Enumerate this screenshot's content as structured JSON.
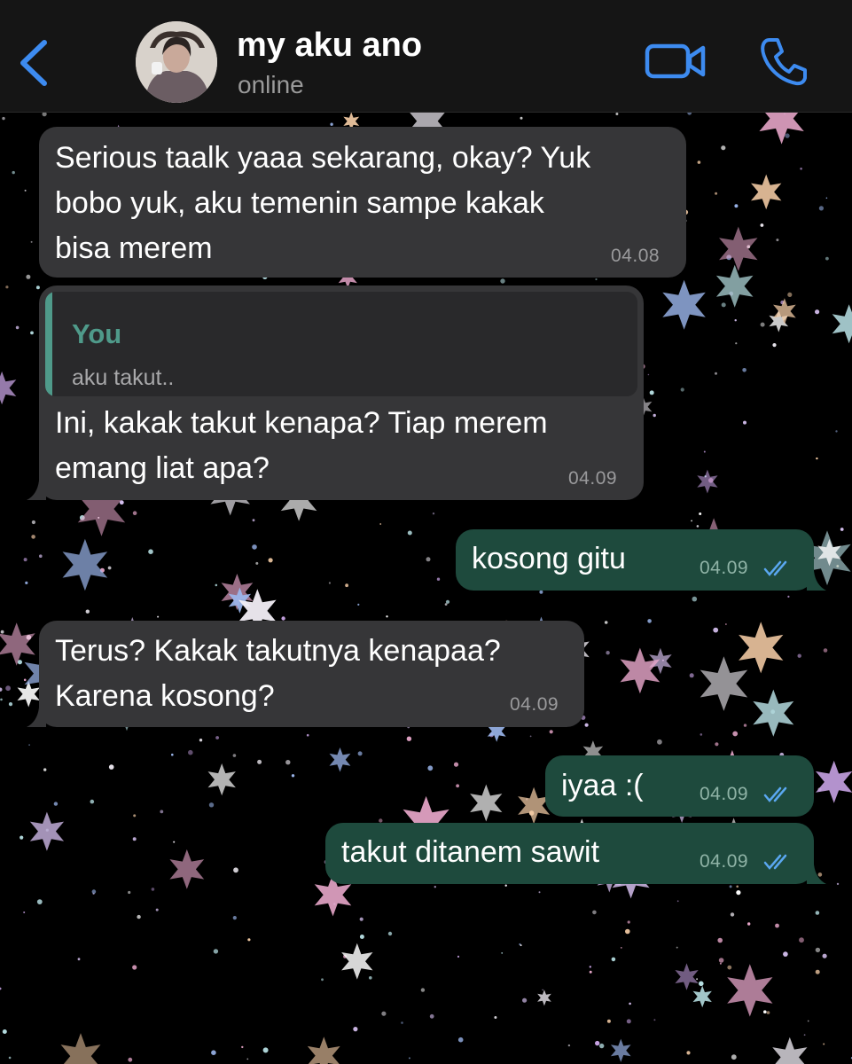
{
  "header": {
    "contact_name": "my aku ano",
    "status": "online",
    "back_icon": "chevron-left-icon",
    "video_icon": "video-camera-icon",
    "call_icon": "phone-icon",
    "accent_color": "#3d8bf0"
  },
  "messages": [
    {
      "direction": "incoming",
      "lines": [
        "Serious taalk yaaa sekarang, okay? Yuk",
        "bobo yuk, aku temenin sampe kakak",
        "bisa merem"
      ],
      "time": "04.08"
    },
    {
      "direction": "incoming",
      "reply_to": {
        "author": "You",
        "text": "aku takut.."
      },
      "lines": [
        "Ini, kakak takut kenapa? Tiap merem",
        "emang liat apa?"
      ],
      "time": "04.09"
    },
    {
      "direction": "outgoing",
      "lines": [
        "kosong gitu"
      ],
      "time": "04.09",
      "status": "read"
    },
    {
      "direction": "incoming",
      "lines": [
        "Terus? Kakak takutnya kenapaa?",
        "Karena kosong?"
      ],
      "time": "04.09"
    },
    {
      "direction": "outgoing",
      "lines": [
        "iyaa :("
      ],
      "time": "04.09",
      "status": "read"
    },
    {
      "direction": "outgoing",
      "lines": [
        "takut ditanem sawit"
      ],
      "time": "04.09",
      "status": "read"
    }
  ],
  "colors": {
    "incoming_bubble": "#363638",
    "outgoing_bubble": "#1e4a3d",
    "quote_accent": "#4f9a8a",
    "read_ticks": "#5aa7f0"
  }
}
